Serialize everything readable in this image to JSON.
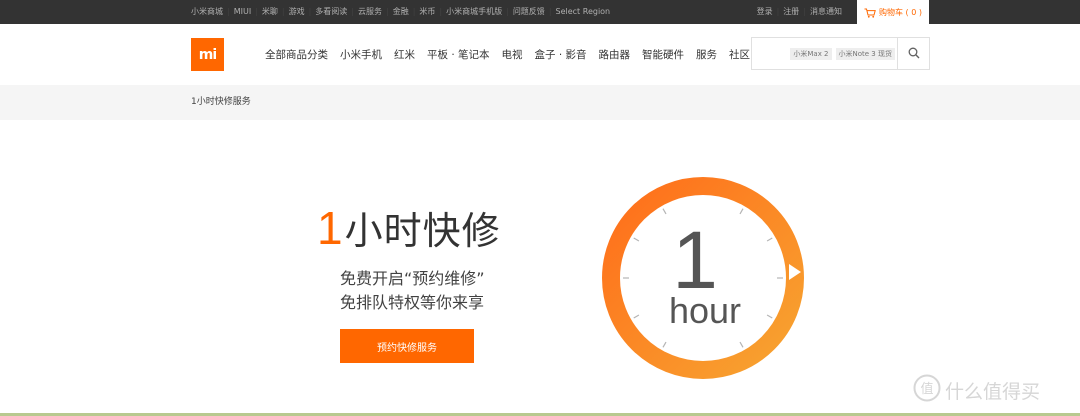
{
  "topbar": {
    "links": [
      "小米商城",
      "MIUI",
      "米聊",
      "游戏",
      "多看阅读",
      "云服务",
      "金融",
      "米币",
      "小米商城手机版",
      "问题反馈",
      "Select Region"
    ],
    "login": "登录",
    "register": "注册",
    "messages": "消息通知",
    "cart": "购物车 ( 0 )"
  },
  "header": {
    "logo_text": "mi",
    "nav": [
      "全部商品分类",
      "小米手机",
      "红米",
      "平板 · 笔记本",
      "电视",
      "盒子 · 影音",
      "路由器",
      "智能硬件",
      "服务",
      "社区"
    ],
    "search_hints": [
      "小米Max 2",
      "小米Note 3 现货"
    ]
  },
  "breadcrumb": "1小时快修服务",
  "hero": {
    "title_number": "1",
    "title_text": "小时快修",
    "line1": "免费开启“预约维修”",
    "line2": "免排队特权等你来享",
    "button": "预约快修服务",
    "clock_number": "1",
    "clock_unit": "hour"
  },
  "watermark": "什么值得买",
  "colors": {
    "accent": "#ff6700",
    "ring_start": "#ff6d1a",
    "ring_end": "#f7a531",
    "topbar_bg": "#333333",
    "crumb_bg": "#f5f5f5"
  }
}
